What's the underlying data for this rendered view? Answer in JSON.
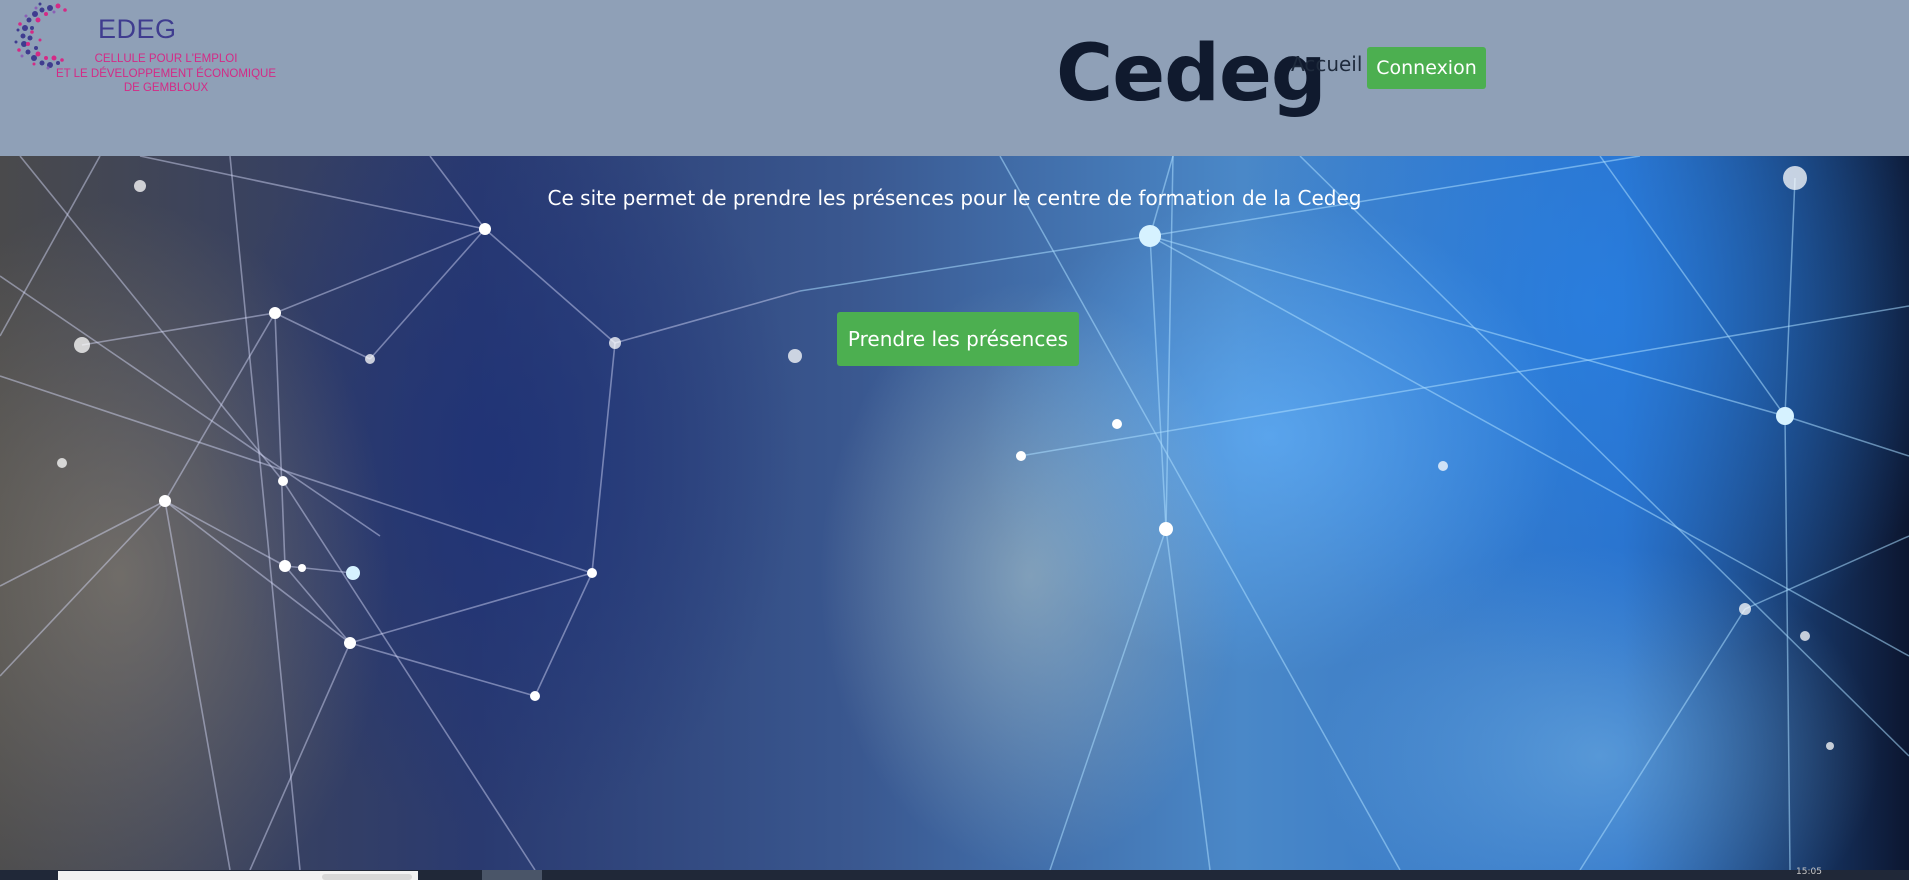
{
  "header": {
    "logo": {
      "word": "EDEG",
      "subtitle_lines": [
        "Cellule pour l'emploi",
        "et le développement économique",
        "de Gembloux"
      ],
      "brand_color": "#3f3c8f",
      "accent_color": "#d42a86"
    },
    "site_title": "Cedeg",
    "nav": {
      "home_label": "Accueil",
      "login_label": "Connexion"
    },
    "background_color": "#8fa0b7"
  },
  "hero": {
    "description": "Ce site permet de prendre les présences pour le centre de formation de la Cedeg",
    "cta_label": "Prendre les présences",
    "button_color": "#4caf50"
  },
  "taskbar": {
    "clock": "15:05"
  }
}
